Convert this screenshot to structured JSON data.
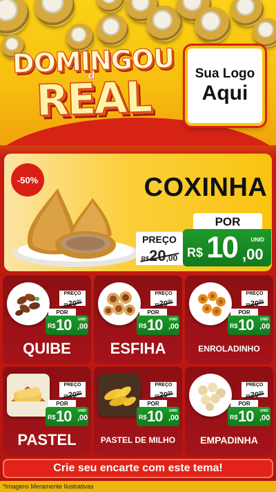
{
  "header": {
    "title_top": "DOMINGOU",
    "title_connector": "d",
    "title_main": "REAL",
    "logo_line1": "Sua Logo",
    "logo_line2": "Aqui"
  },
  "hero": {
    "discount": "-50%",
    "name": "COXINHA",
    "preco_label": "PREÇO",
    "old_currency": "R$",
    "old_value": "20",
    "old_cents": ",00",
    "por_label": "POR",
    "currency": "R$",
    "price": "10",
    "cents": ",00",
    "unit": "UNID"
  },
  "price_common": {
    "preco_label": "PREÇO",
    "old_currency": "R$",
    "old_value": "20",
    "old_cents": "00",
    "por_label": "POR",
    "currency": "R$",
    "price": "10",
    "cents": ",00",
    "unit": "UNID"
  },
  "products": [
    {
      "name": "QUIBE"
    },
    {
      "name": "ESFIHA"
    },
    {
      "name": "ENROLADINHO"
    },
    {
      "name": "PASTEL"
    },
    {
      "name": "PASTEL DE MILHO"
    },
    {
      "name": "EMPADINHA"
    }
  ],
  "cta": "Crie seu encarte com este tema!",
  "disclaimer": "*Imagens Meramente Ilustrativas"
}
